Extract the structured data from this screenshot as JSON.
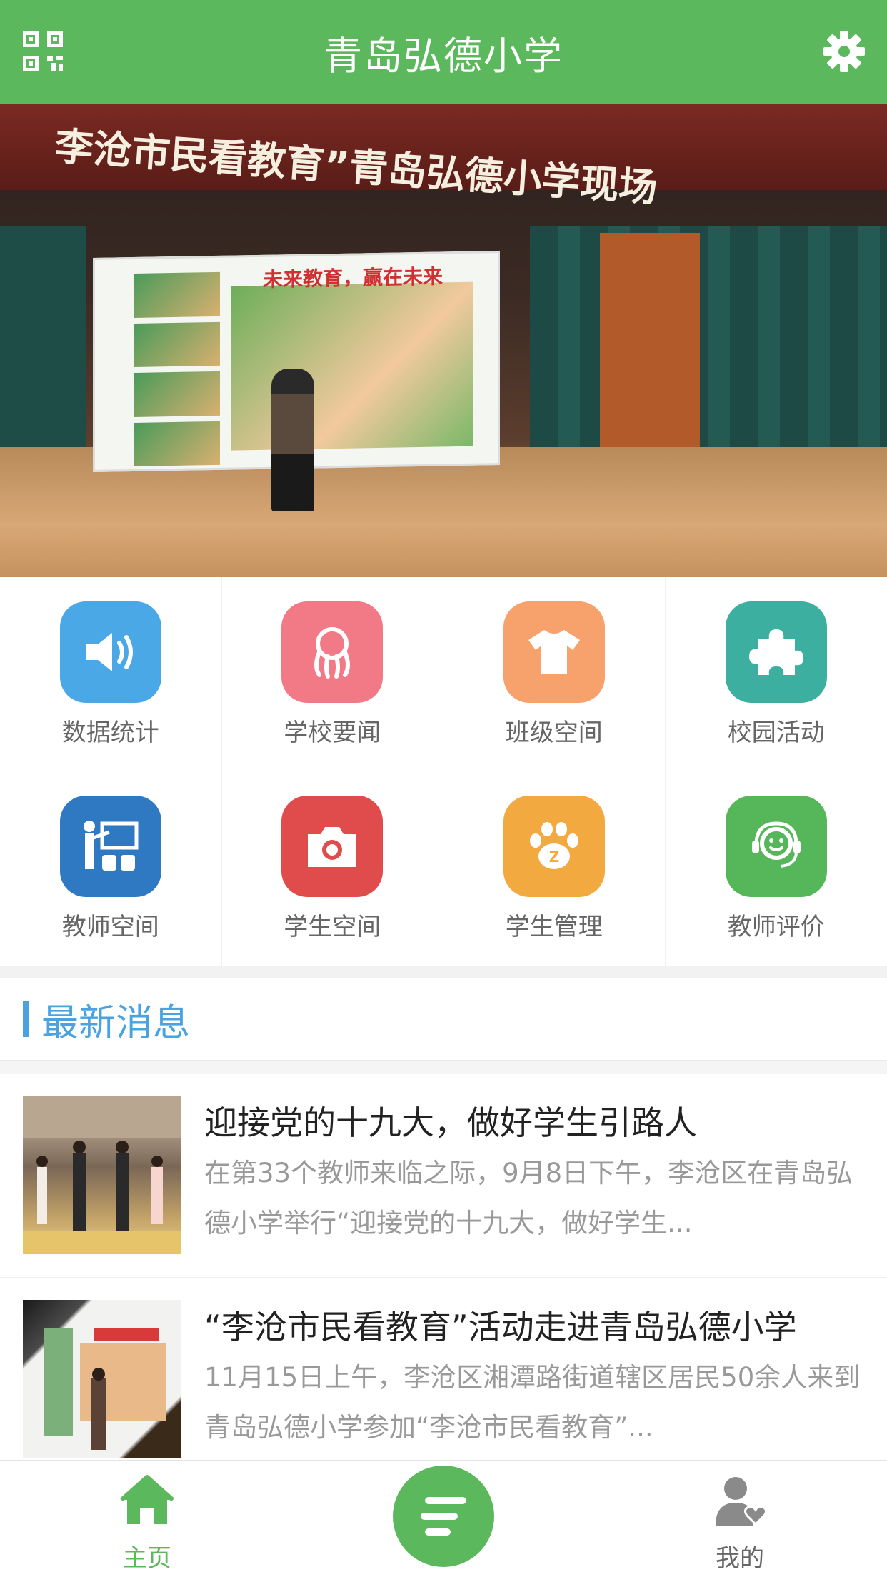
{
  "header": {
    "title": "青岛弘德小学",
    "left_icon": "qr-code-icon",
    "right_icon": "gear-icon"
  },
  "banner": {
    "headline": "李沧市民看教育”青岛弘德小学现场",
    "screen_slogan": "未来教育，赢在未来",
    "slides_total": 1,
    "active_slide": 1
  },
  "grid": {
    "items": [
      {
        "label": "数据统计",
        "icon": "speaker-icon",
        "color": "#4ba8e6"
      },
      {
        "label": "学校要闻",
        "icon": "octopus-icon",
        "color": "#f27a86"
      },
      {
        "label": "班级空间",
        "icon": "tshirt-icon",
        "color": "#f7a26c"
      },
      {
        "label": "校园活动",
        "icon": "puzzle-icon",
        "color": "#3dafa0"
      },
      {
        "label": "教师空间",
        "icon": "teacher-board-icon",
        "color": "#2e79c2"
      },
      {
        "label": "学生空间",
        "icon": "camera-icon",
        "color": "#e04c4c"
      },
      {
        "label": "学生管理",
        "icon": "paw-icon",
        "color": "#f2a940"
      },
      {
        "label": "教师评价",
        "icon": "headset-smile-icon",
        "color": "#55b65a"
      }
    ]
  },
  "section": {
    "title": "最新消息"
  },
  "news": [
    {
      "title": "迎接党的十九大，做好学生引路人",
      "desc": "在第33个教师来临之际，9月8日下午，李沧区在青岛弘德小学举行“迎接党的十九大，做好学生..."
    },
    {
      "title": "“李沧市民看教育”活动走进青岛弘德小学",
      "desc": "11月15日上午，李沧区湘潭路街道辖区居民50余人来到青岛弘德小学参加“李沧市民看教育”..."
    }
  ],
  "tabbar": {
    "home_label": "主页",
    "mine_label": "我的",
    "active_color": "#5cb85c"
  }
}
